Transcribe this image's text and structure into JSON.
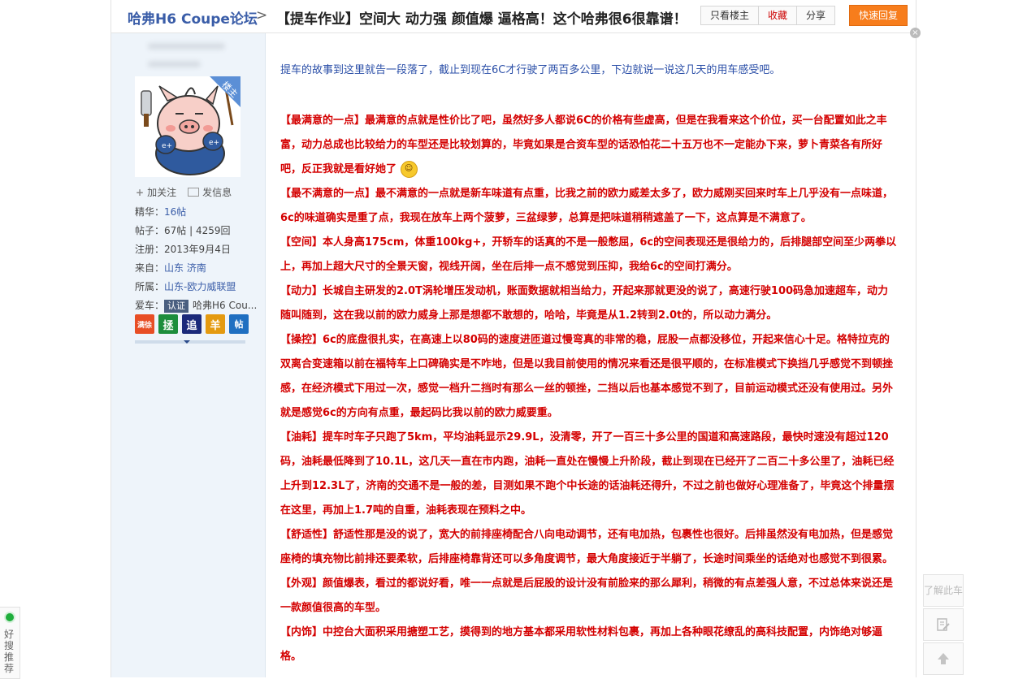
{
  "left_float": {
    "label": "好搜推荐"
  },
  "topbar": {
    "forum_name": "哈弗H6 Coupe论坛",
    "separator": ">",
    "post_title": "【提车作业】空间大 动力强 颜值爆 逼格高！这个哈弗很6很靠谱！",
    "buttons": [
      "只看楼主",
      "收藏",
      "分享"
    ],
    "reply_button": "快速回复"
  },
  "sidebar": {
    "owner_badge": "楼主",
    "follow_label": "加关注",
    "message_label": "发信息",
    "stats": [
      {
        "label": "精华：",
        "value": "16帖"
      },
      {
        "label": "帖子：",
        "value": "67帖 | 4259回"
      },
      {
        "label": "注册：",
        "value": "2013年9月4日"
      },
      {
        "label": "来自：",
        "value": "山东 济南"
      },
      {
        "label": "所属：",
        "value": "山东-欧力威联盟"
      },
      {
        "label": "爱车：",
        "cert": "认证",
        "value": "哈弗H6 Cou..."
      }
    ],
    "badges": [
      "满徐",
      "拯",
      "追",
      "羊",
      "帖"
    ]
  },
  "content": {
    "intro": "提车的故事到这里就告一段落了，截止到现在6C才行驶了两百多公里，下边就说一说这几天的用车感受吧。",
    "paragraphs": [
      "【最满意的一点】最满意的点就是性价比了吧，虽然好多人都说6C的价格有些虚高，但是在我看来这个价位，买一台配置如此之丰富，动力总成也比较给力的车型还是比较划算的，毕竟如果是合资车型的话恐怕花二十五万也不一定能办下来，萝卜青菜各有所好吧，反正我就是看好她了",
      "【最不满意的一点】最不满意的一点就是新车味道有点重，比我之前的欧力威差太多了，欧力威刚买回来时车上几乎没有一点味道，6c的味道确实是重了点，我现在放车上两个菠萝，三盆绿萝，总算是把味道稍稍遮盖了一下，这点算是不满意了。",
      "【空间】本人身高175cm，体重100kg+，开轿车的话真的不是一般憋屈，6c的空间表现还是很给力的，后排腿部空间至少两拳以上，再加上超大尺寸的全景天窗，视线开阔，坐在后排一点不感觉到压抑，我给6c的空间打满分。",
      "【动力】长城自主研发的2.0T涡轮增压发动机，账面数据就相当给力，开起来那就更没的说了，高速行驶100码急加速超车，动力随叫随到，这在我以前的欧力威身上那是想都不敢想的，哈哈，毕竟是从1.2转到2.0t的，所以动力满分。",
      "【操控】6c的底盘很扎实，在高速上以80码的速度进匝道过慢弯真的非常的稳，屁股一点都没移位，开起来信心十足。格特拉克的双离合变速箱以前在福特车上口碑确实是不咋地，但是以我目前使用的情况来看还是很平顺的，在标准模式下换挡几乎感觉不到顿挫感，在经济模式下用过一次，感觉一档升二挡时有那么一丝的顿挫，二挡以后也基本感觉不到了，目前运动模式还没有使用过。另外就是感觉6c的方向有点重，最起码比我以前的欧力威要重。",
      "【油耗】提车时车子只跑了5km，平均油耗显示29.9L，没清零，开了一百三十多公里的国道和高速路段，最快时速没有超过120码，油耗最低降到了10.1L，这几天一直在市内跑，油耗一直处在慢慢上升阶段，截止到现在已经开了二百二十多公里了，油耗已经上升到12.3L了，济南的交通不是一般的差，目测如果不跑个中长途的话油耗还得升，不过之前也做好心理准备了，毕竟这个排量摆在这里，再加上1.7吨的自重，油耗表现在预料之中。",
      "【舒适性】舒适性那是没的说了，宽大的前排座椅配合八向电动调节，还有电加热，包裹性也很好。后排虽然没有电加热，但是感觉座椅的填充物比前排还要柔软，后排座椅靠背还可以多角度调节，最大角度接近于半躺了，长途时间乘坐的话绝对也感觉不到很累。",
      "【外观】颜值爆表，看过的都说好看，唯一一点就是后屁股的设计没有前脸来的那么犀利，稍微的有点差强人意，不过总体来说还是一款颜值很高的车型。",
      "【内饰】中控台大面积采用搪塑工艺，摸得到的地方基本都采用软性材料包裹，再加上各种眼花缭乱的高科技配置，内饰绝对够逼格。"
    ]
  },
  "tools": {
    "learn_car": "了解此车"
  }
}
